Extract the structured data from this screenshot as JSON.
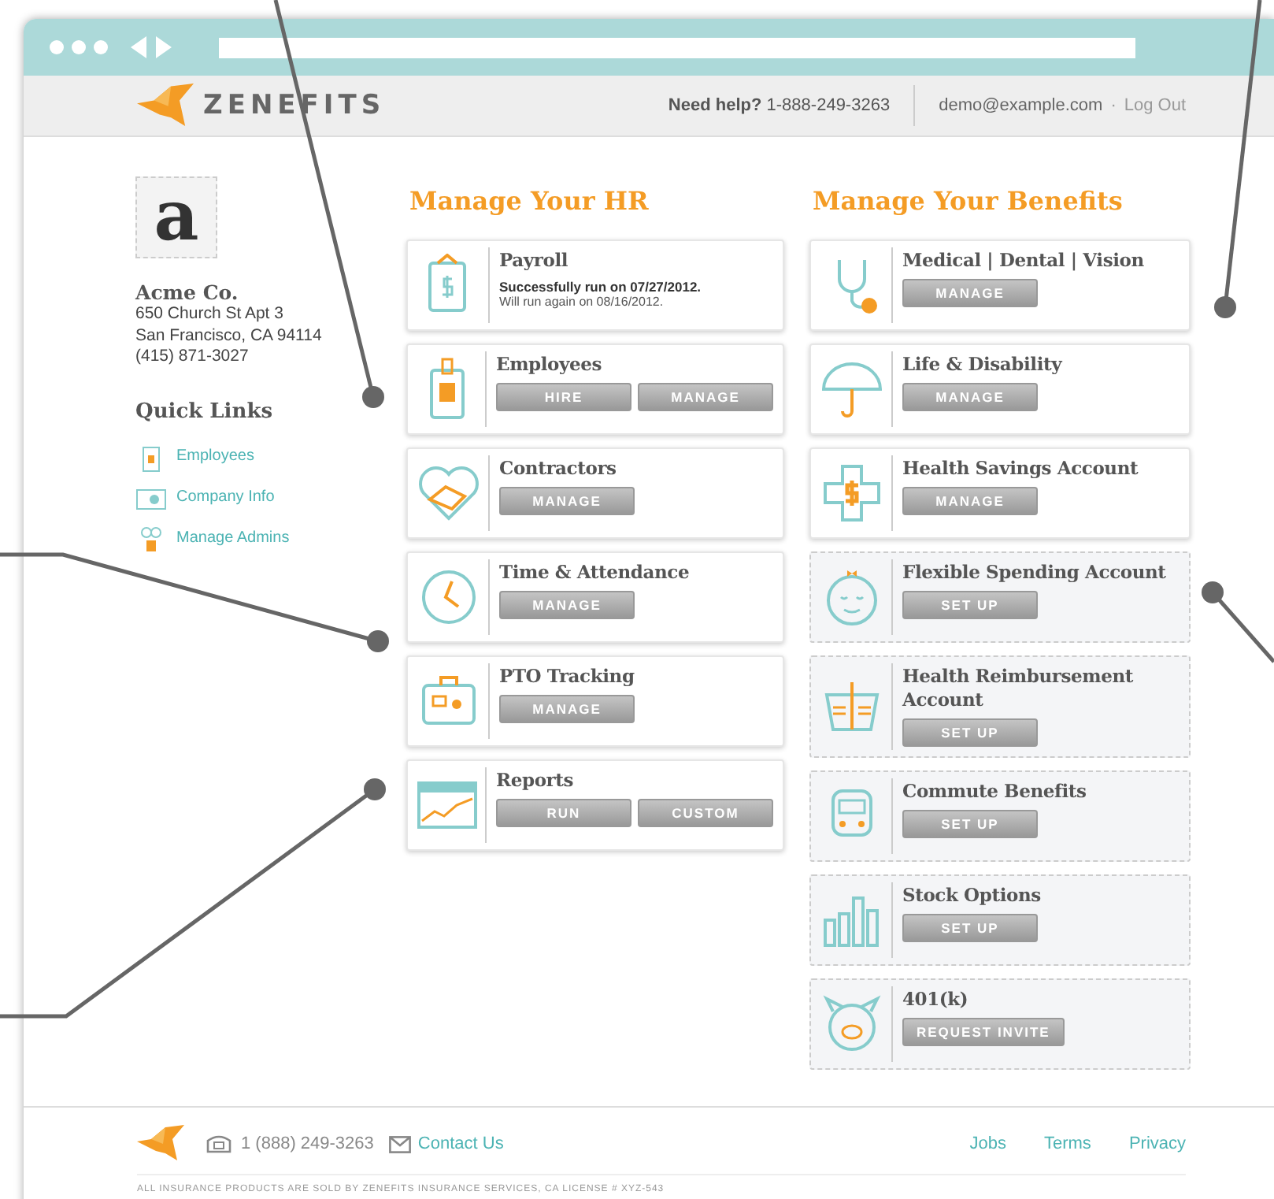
{
  "header": {
    "brand": "ZENEFITS",
    "help_label": "Need help?",
    "help_phone": "1-888-249-3263",
    "email": "demo@example.com",
    "separator": "·",
    "logout": "Log Out"
  },
  "company": {
    "logo_letter": "a",
    "name": "Acme Co.",
    "address": [
      "650 Church St Apt 3",
      "San Francisco, CA 94114",
      "(415) 871-3027"
    ]
  },
  "quick_links": {
    "title": "Quick Links",
    "items": [
      "Employees",
      "Company Info",
      "Manage Admins"
    ]
  },
  "hr": {
    "title": "Manage Your HR",
    "cards": [
      {
        "title": "Payroll",
        "kind": "active",
        "status": "Successfully run on 07/27/2012.",
        "note": "Will run again on 08/16/2012."
      },
      {
        "title": "Employees",
        "kind": "active",
        "buttons": [
          "HIRE",
          "MANAGE"
        ]
      },
      {
        "title": "Contractors",
        "kind": "active",
        "buttons": [
          "MANAGE"
        ]
      },
      {
        "title": "Time & Attendance",
        "kind": "active",
        "buttons": [
          "MANAGE"
        ]
      },
      {
        "title": "PTO Tracking",
        "kind": "active",
        "buttons": [
          "MANAGE"
        ]
      },
      {
        "title": "Reports",
        "kind": "active",
        "buttons": [
          "RUN",
          "CUSTOM"
        ]
      }
    ]
  },
  "benefits": {
    "title": "Manage Your Benefits",
    "cards": [
      {
        "title": "Medical | Dental | Vision",
        "kind": "active",
        "buttons": [
          "MANAGE"
        ]
      },
      {
        "title": "Life & Disability",
        "kind": "active",
        "buttons": [
          "MANAGE"
        ]
      },
      {
        "title": "Health Savings Account",
        "kind": "active",
        "buttons": [
          "MANAGE"
        ]
      },
      {
        "title": "Flexible Spending Account",
        "kind": "setup",
        "buttons": [
          "SET UP"
        ]
      },
      {
        "title": "Health Reimbursement Account",
        "kind": "setup",
        "buttons": [
          "SET UP"
        ]
      },
      {
        "title": "Commute Benefits",
        "kind": "setup",
        "buttons": [
          "SET UP"
        ]
      },
      {
        "title": "Stock Options",
        "kind": "setup",
        "buttons": [
          "SET UP"
        ]
      },
      {
        "title": "401(k)",
        "kind": "setup",
        "buttons": [
          "REQUEST INVITE"
        ]
      }
    ]
  },
  "footer": {
    "phone": "1 (888) 249-3263",
    "contact": "Contact Us",
    "links": [
      "Jobs",
      "Terms",
      "Privacy"
    ],
    "fine_print": "ALL INSURANCE PRODUCTS ARE SOLD BY ZENEFITS INSURANCE SERVICES, CA LICENSE # XYZ-543"
  }
}
